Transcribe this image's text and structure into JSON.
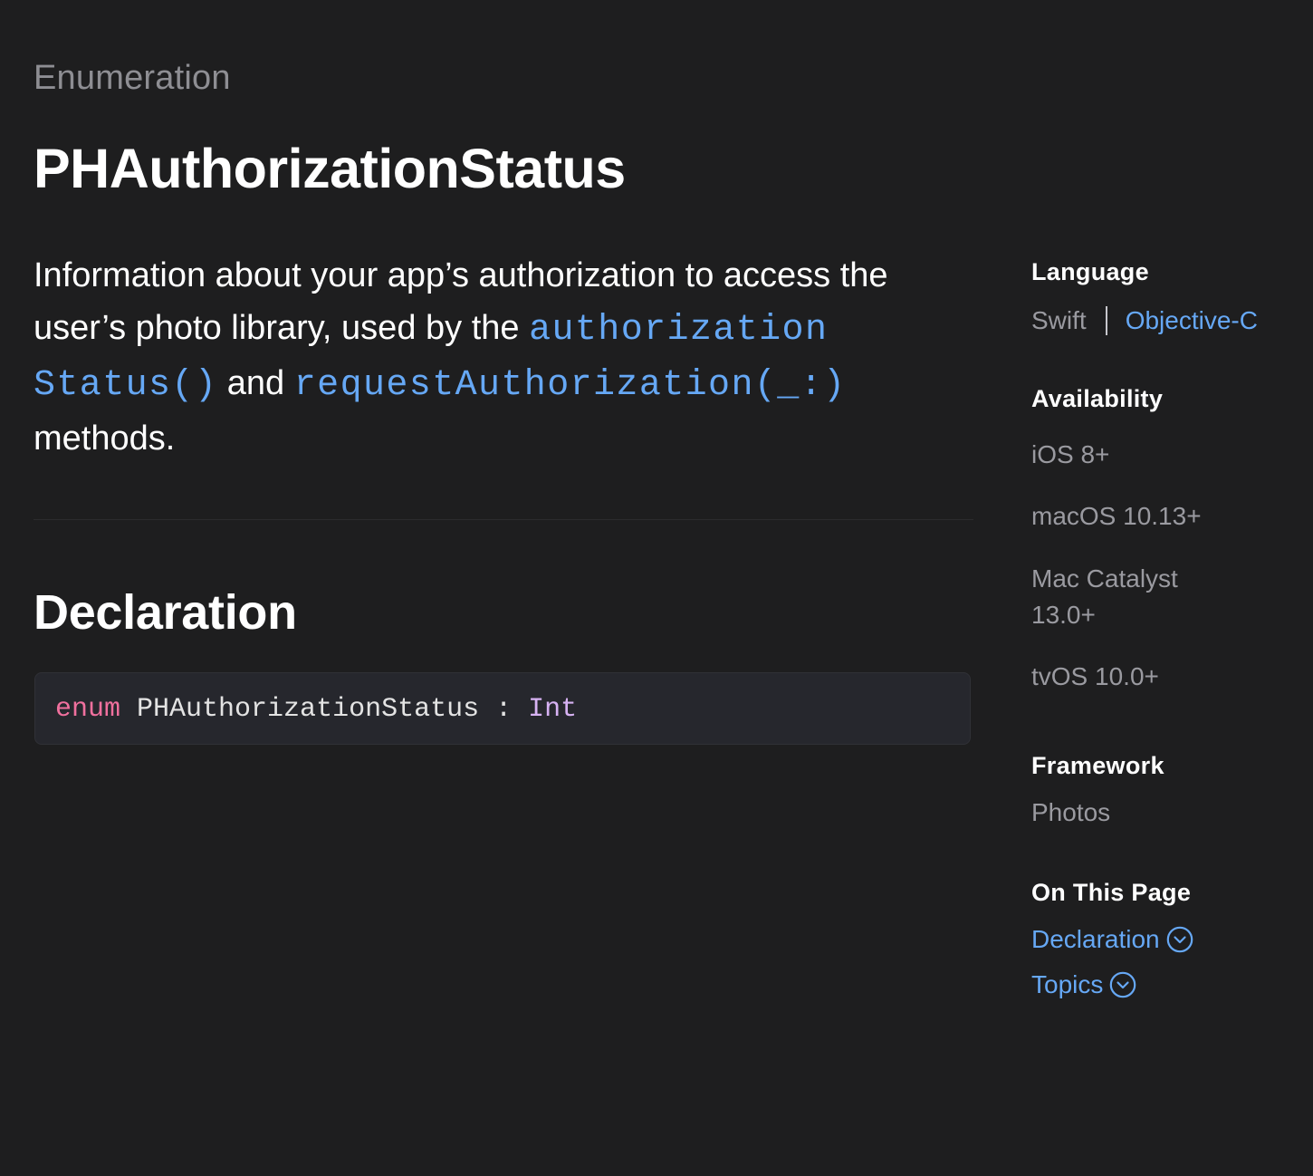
{
  "header": {
    "eyebrow": "Enumeration",
    "title": "PHAuthorizationStatus"
  },
  "abstract": {
    "text_1": "Information about your app’s authorization to access the user’s photo library, used by the ",
    "link_1": "authorization Status()",
    "text_2": " and ",
    "link_2": "requestAuthorization(_:)",
    "text_3": " methods."
  },
  "declaration": {
    "heading": "Declaration",
    "keyword": "enum",
    "name": "PHAuthorizationStatus",
    "colon": ":",
    "type": "Int"
  },
  "sidebar": {
    "language": {
      "heading": "Language",
      "current": "Swift",
      "other": "Objective-C"
    },
    "availability": {
      "heading": "Availability",
      "items": [
        "iOS 8+",
        "macOS 10.13+",
        "Mac Catalyst",
        "13.0+",
        "tvOS 10.0+"
      ]
    },
    "framework": {
      "heading": "Framework",
      "name": "Photos"
    },
    "on_this_page": {
      "heading": "On This Page",
      "links": [
        "Declaration",
        "Topics"
      ]
    }
  },
  "colors": {
    "background": "#1e1e1f",
    "link": "#66a8f5",
    "keyword": "#f0709e",
    "type": "#d7b2f3",
    "muted": "#9a9aa0"
  },
  "icons": {
    "toc_chevron": "chevron-down-circle-icon"
  }
}
